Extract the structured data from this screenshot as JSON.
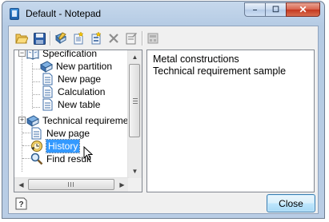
{
  "window": {
    "title": "Default - Notepad",
    "controls": {
      "minimize": "–",
      "maximize": "☐",
      "close": "✕"
    }
  },
  "toolbar": {
    "buttons": [
      "open-icon",
      "save-icon",
      "edit-icon",
      "new-page-icon",
      "new-item-icon",
      "delete-icon",
      "properties-icon",
      "disabled-view-icon"
    ]
  },
  "tree": {
    "items": [
      {
        "label": "Specification",
        "icon": "open-book-icon"
      },
      {
        "label": "New partition",
        "icon": "book-icon"
      },
      {
        "label": "New page",
        "icon": "page-icon"
      },
      {
        "label": "Calculation",
        "icon": "page-icon"
      },
      {
        "label": "New table",
        "icon": "page-icon"
      },
      {
        "label": "Technical requirement",
        "icon": "book-icon"
      },
      {
        "label": "New page",
        "icon": "page-icon"
      },
      {
        "label": "History",
        "icon": "history-icon",
        "selected": true
      },
      {
        "label": "Find result",
        "icon": "magnifier-icon"
      }
    ],
    "expander_expanded": "−",
    "expander_collapsed": "+"
  },
  "content": {
    "lines": [
      "Metal constructions",
      "Technical requirement sample"
    ]
  },
  "footer": {
    "close_label": "Close",
    "help_icon": "help-icon"
  },
  "colors": {
    "selection": "#3399ff",
    "title_gradient_top": "#c6d8ec",
    "close_red": "#c4371f"
  }
}
